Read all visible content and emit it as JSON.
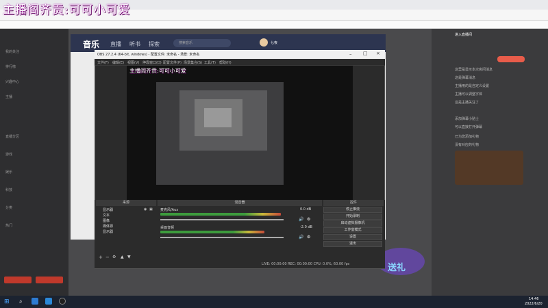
{
  "overlay_title": "主播阎齐贡:可可小可爱",
  "obs": {
    "title": "OBS 27.2.4 (64-bit, windows) - 配置文件: 未命名 - 场景: 未命名",
    "menu": [
      "文件(F)",
      "编辑(E)",
      "视图(V)",
      "停靠窗口(D)",
      "配置文件(P)",
      "场景集合(S)",
      "工具(T)",
      "帮助(H)"
    ],
    "preview_caption": "主播阎齐贡:可可小可爱",
    "docks": {
      "sources": "来源",
      "mixer": "混音器",
      "controls": "控件"
    },
    "sources": [
      "显示器",
      "文本",
      "图像",
      "媒体源",
      "显示器"
    ],
    "mixer": [
      {
        "name": "麦克风/Aux",
        "db": "0.0 dB",
        "level": 0.88
      },
      {
        "name": "桌面音频",
        "db": "-2.0 dB",
        "level": 0.76
      }
    ],
    "controls": [
      "停止推流",
      "开始录制",
      "启动虚拟摄像机",
      "工作室模式",
      "设置",
      "退出"
    ],
    "status": "LIVE: 00:00:00   REC: 00:00:00   CPU: 0.0%, 60.00 fps"
  },
  "music": {
    "title": "音乐",
    "tabs": [
      "直播",
      "听书",
      "探索"
    ],
    "search_placeholder": "搜索音乐",
    "username": "七夜"
  },
  "chat": {
    "header": "进入直播间",
    "messages": [
      "这里是显示本次房间消息",
      "这是弹幕消息",
      "主播用的是自定义设置",
      "主播可以调整字体",
      "这是主播关注了",
      "添加弹幕小贴士",
      "可以直接打开弹幕",
      "已为您添加礼物",
      "没有对应的礼物"
    ],
    "gift_banner": "送礼"
  },
  "left_menu": [
    "我的关注",
    "排行榜",
    "兴趣中心",
    "主播",
    "直播分区",
    "游戏",
    "娱乐",
    "科技",
    "分类",
    "热门"
  ],
  "taskbar": {
    "time": "14:46",
    "date": "2022/6/20"
  }
}
